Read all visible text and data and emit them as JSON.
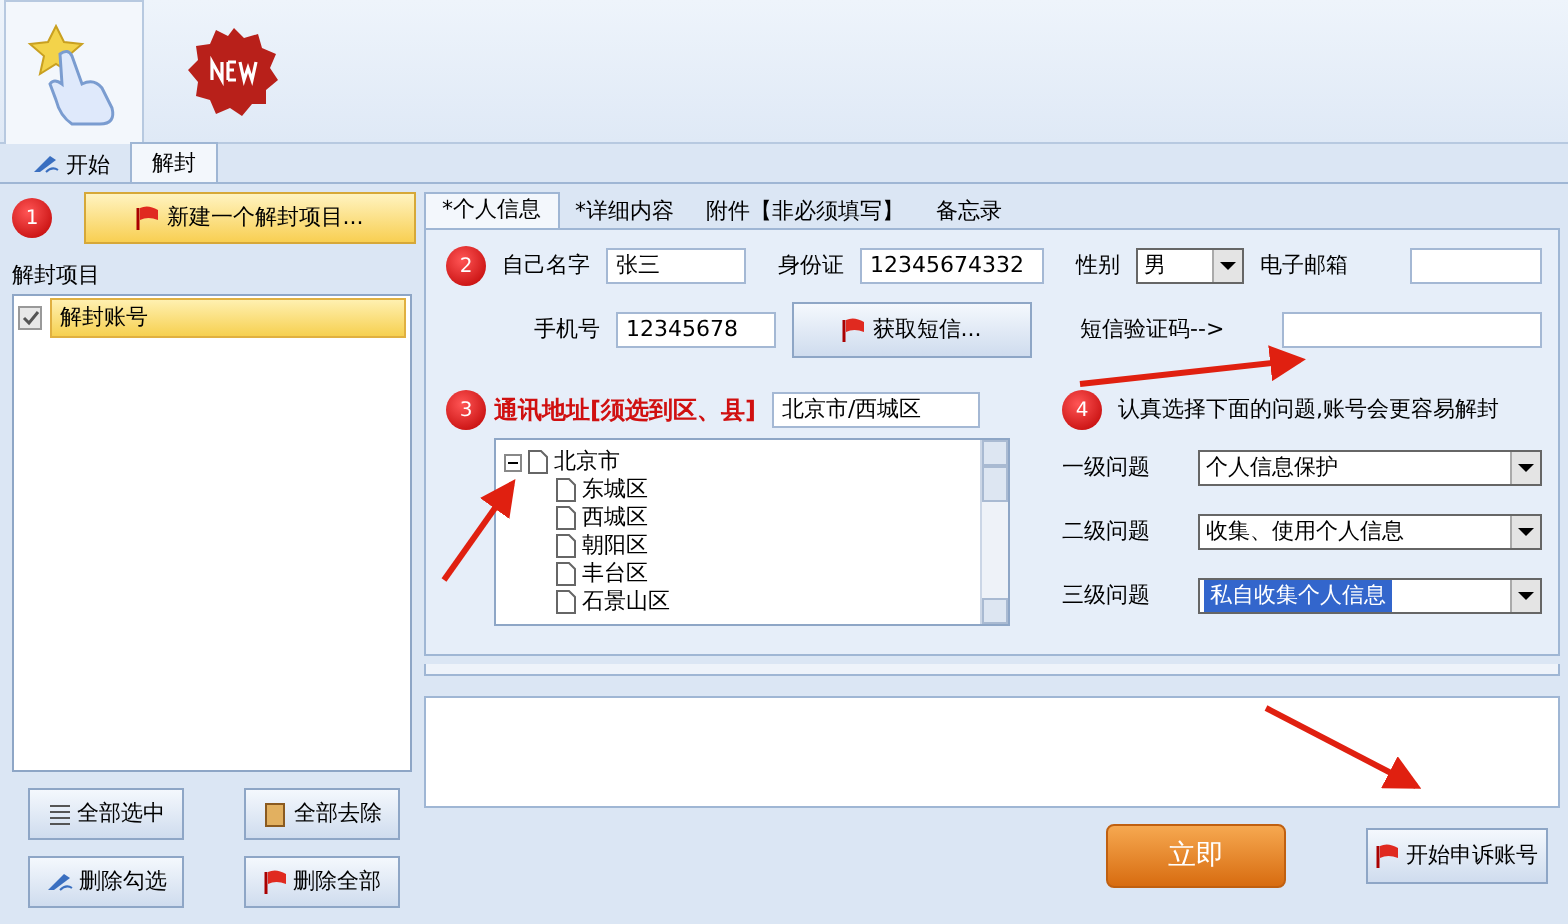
{
  "main_tabs": [
    {
      "label": "开始",
      "selected": false
    },
    {
      "label": "解封",
      "selected": true
    }
  ],
  "left": {
    "step": "1",
    "new_button": "新建一个解封项目...",
    "group_label": "解封项目",
    "items": [
      {
        "label": "解封账号",
        "checked": true,
        "selected": true
      }
    ],
    "buttons": [
      "全部选中",
      "全部去除",
      "删除勾选",
      "删除全部"
    ]
  },
  "form_tabs": [
    {
      "label": "*个人信息",
      "selected": true
    },
    {
      "label": "*详细内容",
      "selected": false
    },
    {
      "label": "附件【非必须填写】",
      "selected": false
    },
    {
      "label": "备忘录",
      "selected": false
    }
  ],
  "personal": {
    "step": "2",
    "name_label": "自己名字",
    "name_value": "张三",
    "id_label": "身份证",
    "id_value": "12345674332",
    "gender_label": "性别",
    "gender_value": "男",
    "email_label": "电子邮箱",
    "phone_label": "手机号",
    "phone_value": "12345678",
    "sms_button": "获取短信...",
    "code_label": "短信验证码-->"
  },
  "address": {
    "step": "3",
    "label": "通讯地址[须选到区、县]",
    "value": "北京市/西城区",
    "tree": [
      {
        "label": "北京市",
        "expanded": true,
        "children": [
          {
            "label": "东城区"
          },
          {
            "label": "西城区"
          },
          {
            "label": "朝阳区"
          },
          {
            "label": "丰台区"
          },
          {
            "label": "石景山区"
          }
        ]
      }
    ]
  },
  "questions": {
    "step": "4",
    "hint": "认真选择下面的问题,账号会更容易解封",
    "rows": [
      {
        "label": "一级问题",
        "value": "个人信息保护",
        "selected": false
      },
      {
        "label": "二级问题",
        "value": "收集、使用个人信息",
        "selected": false
      },
      {
        "label": "三级问题",
        "value": "私自收集个人信息",
        "selected": true
      }
    ]
  },
  "actions": [
    {
      "label": "立即",
      "kind": "primary"
    },
    {
      "label": "开始申诉账号",
      "kind": "secondary"
    }
  ]
}
